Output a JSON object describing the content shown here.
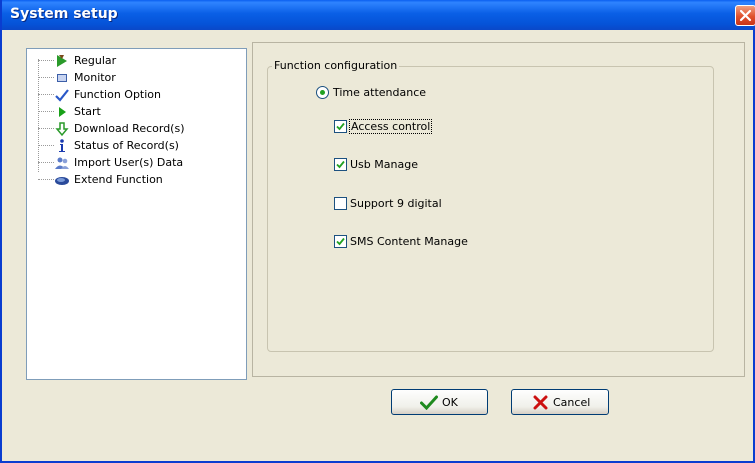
{
  "window": {
    "title": "System setup"
  },
  "tree": {
    "items": [
      {
        "label": "Regular",
        "icon": "green-arrow-icon"
      },
      {
        "label": "Monitor",
        "icon": "monitor-icon"
      },
      {
        "label": "Function Option",
        "icon": "checkmark-icon"
      },
      {
        "label": "Start",
        "icon": "play-icon"
      },
      {
        "label": "Download Record(s)",
        "icon": "download-arrow-icon"
      },
      {
        "label": "Status of Record(s)",
        "icon": "info-icon"
      },
      {
        "label": "Import User(s) Data",
        "icon": "users-icon"
      },
      {
        "label": "Extend Function",
        "icon": "extend-icon"
      }
    ]
  },
  "function_config": {
    "group_title": "Function configuration",
    "radio": {
      "label": "Time attendance",
      "selected": true
    },
    "checkboxes": [
      {
        "label": "Access control",
        "checked": true,
        "focused": true
      },
      {
        "label": "Usb Manage",
        "checked": true
      },
      {
        "label": "Support 9 digital",
        "checked": false
      },
      {
        "label": "SMS Content Manage",
        "checked": true
      }
    ]
  },
  "buttons": {
    "ok_label": "OK",
    "cancel_label": "Cancel"
  },
  "colors": {
    "titlebar": "#0a5fe6",
    "background": "#ece9d8",
    "check": "#21a121",
    "cancel_x": "#cc1010"
  }
}
